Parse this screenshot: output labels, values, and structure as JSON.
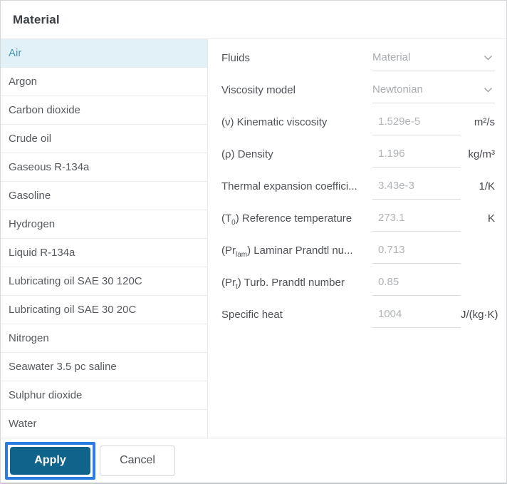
{
  "dialog": {
    "title": "Material"
  },
  "materials": {
    "selected": "Air",
    "items": [
      "Air",
      "Argon",
      "Carbon dioxide",
      "Crude oil",
      "Gaseous R-134a",
      "Gasoline",
      "Hydrogen",
      "Liquid R-134a",
      "Lubricating oil SAE 30 120C",
      "Lubricating oil SAE 30 20C",
      "Nitrogen",
      "Seawater 3.5 pc saline",
      "Sulphur dioxide",
      "Water"
    ]
  },
  "form": {
    "fields": [
      {
        "name": "fluids",
        "label_html": "Fluids",
        "type": "select",
        "value": "Material",
        "unit": ""
      },
      {
        "name": "viscosity-model",
        "label_html": "Viscosity model",
        "type": "select",
        "value": "Newtonian",
        "unit": ""
      },
      {
        "name": "kinematic-viscosity",
        "label_html": "(ν) Kinematic viscosity",
        "type": "input",
        "value": "1.529e-5",
        "unit": "m²/s"
      },
      {
        "name": "density",
        "label_html": "(ρ) Density",
        "type": "input",
        "value": "1.196",
        "unit": "kg/m³"
      },
      {
        "name": "thermal-expansion-coefficient",
        "label_html": "Thermal expansion coeffici...",
        "type": "input",
        "value": "3.43e-3",
        "unit": "1/K"
      },
      {
        "name": "reference-temperature",
        "label_html": "(T<sub>0</sub>) Reference temperature",
        "type": "input",
        "value": "273.1",
        "unit": "K"
      },
      {
        "name": "laminar-prandtl-number",
        "label_html": "(Pr<sub>lam</sub>) Laminar Prandtl nu...",
        "type": "input",
        "value": "0.713",
        "unit": ""
      },
      {
        "name": "turbulent-prandtl-number",
        "label_html": "(Pr<sub>t</sub>) Turb. Prandtl number",
        "type": "input",
        "value": "0.85",
        "unit": ""
      },
      {
        "name": "specific-heat",
        "label_html": "Specific heat",
        "type": "input",
        "value": "1004",
        "unit": "J/(kg·K)"
      }
    ]
  },
  "footer": {
    "apply_label": "Apply",
    "cancel_label": "Cancel"
  },
  "colors": {
    "selected_item_bg": "#e2f1f8",
    "selected_item_text": "#4496b4",
    "apply_button_bg": "#10648c",
    "apply_highlight_ring": "#2b7ce0",
    "disabled_value_text": "#b0b4b7",
    "chevron": "#9aa0a4"
  }
}
